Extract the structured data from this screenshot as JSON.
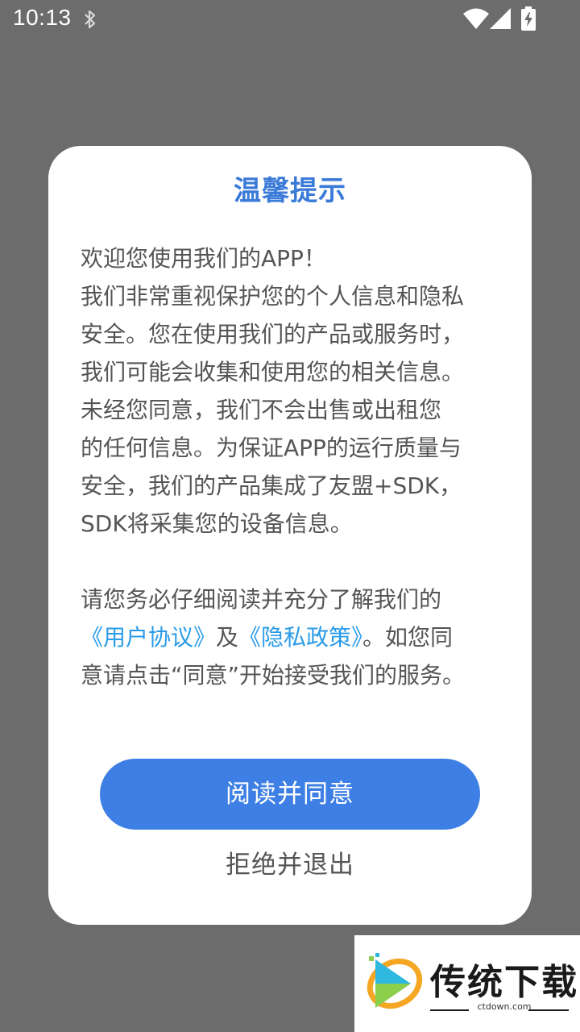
{
  "status_bar": {
    "time": "10:13"
  },
  "dialog": {
    "title": "温馨提示",
    "body_lines": [
      "欢迎您使用我们的APP！",
      "我们非常重视保护您的个人信息和隐私",
      "安全。您在使用我们的产品或服务时，",
      "我们可能会收集和使用您的相关信息。",
      "未经您同意，我们不会出售或出租您",
      "的任何信息。为保证APP的运行质量与",
      "安全，我们的产品集成了友盟+SDK，",
      "SDK将采集您的设备信息。"
    ],
    "para2_line1": "请您务必仔细阅读并充分了解我们的",
    "user_agreement_link": "《用户协议》",
    "and_text": "及",
    "privacy_policy_link": "《隐私政策》",
    "para2_tail": "。如您同",
    "para2_line3": "意请点击“同意”开始接受我们的服务。",
    "agree_button": "阅读并同意",
    "reject_button": "拒绝并退出"
  },
  "watermark": {
    "brand": "传统下载",
    "url": "ctdown.com"
  },
  "colors": {
    "overlay": "#6c6c6c",
    "title": "#3a7ad8",
    "link": "#2a9be8",
    "button": "#3d7fe4",
    "body_text": "#555555"
  }
}
